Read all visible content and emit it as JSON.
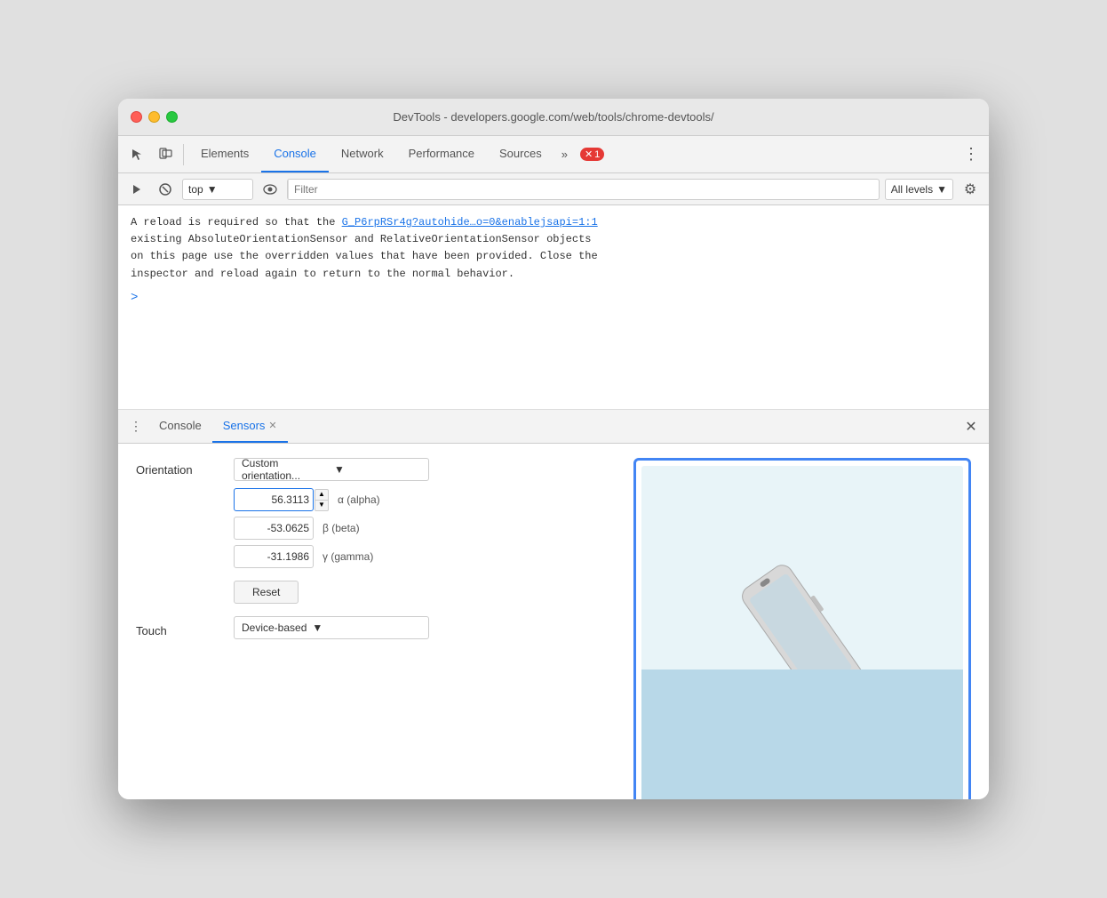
{
  "window": {
    "title": "DevTools - developers.google.com/web/tools/chrome-devtools/"
  },
  "tabs": {
    "items": [
      {
        "label": "Elements",
        "active": false
      },
      {
        "label": "Console",
        "active": true
      },
      {
        "label": "Network",
        "active": false
      },
      {
        "label": "Performance",
        "active": false
      },
      {
        "label": "Sources",
        "active": false
      }
    ],
    "more_label": "»",
    "error_count": "1"
  },
  "console_toolbar": {
    "context_value": "top",
    "context_arrow": "▼",
    "filter_placeholder": "Filter",
    "levels_label": "All levels",
    "levels_arrow": "▼"
  },
  "console_message": {
    "line1": "A reload is required so that the ",
    "link_text": "G_P6rpRSr4g?autohide…o=0&enablejsapi=1:1",
    "line2": "existing AbsoluteOrientationSensor and RelativeOrientationSensor objects",
    "line3": "on this page use the overridden values that have been provided. Close the",
    "line4": "inspector and reload again to return to the normal behavior."
  },
  "bottom_tabs": {
    "items": [
      {
        "label": "Console",
        "active": false,
        "closeable": false
      },
      {
        "label": "Sensors",
        "active": true,
        "closeable": true
      }
    ],
    "close_btn": "✕"
  },
  "sensors": {
    "orientation_label": "Orientation",
    "orientation_select_value": "Custom orientation...",
    "alpha_value": "56.3113",
    "alpha_unit": "α (alpha)",
    "beta_value": "-53.0625",
    "beta_unit": "β (beta)",
    "gamma_value": "-31.1986",
    "gamma_unit": "γ (gamma)",
    "reset_label": "Reset",
    "touch_label": "Touch",
    "touch_select_value": "Device-based"
  }
}
